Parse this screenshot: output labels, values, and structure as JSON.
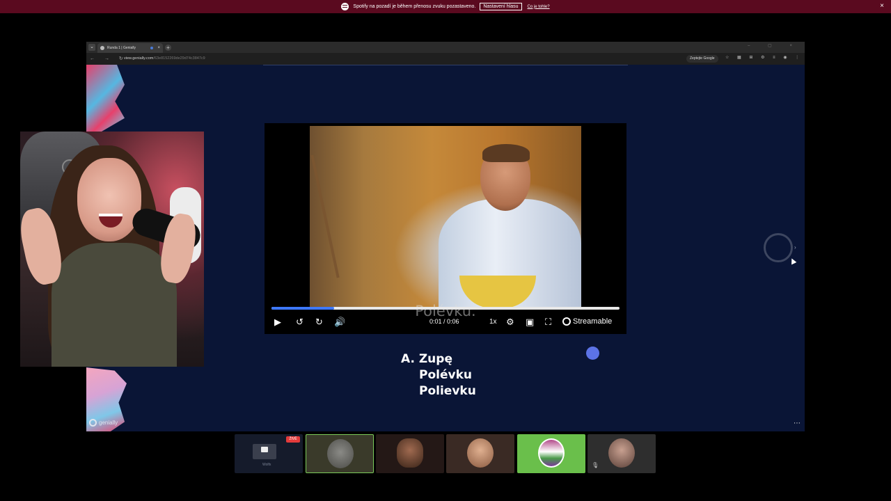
{
  "notification": {
    "message": "Spotify na pozadí je během přenosu zvuku pozastaveno.",
    "settings_button": "Nastavení hlasu",
    "link": "Co je tohle?",
    "close": "×"
  },
  "browser": {
    "tab_title": "Runda 1 | Genially",
    "tab_close": "×",
    "new_tab": "+",
    "window_controls": "– ▢ ×",
    "nav_icons": "← → ↻",
    "url_host": "view.genially.com",
    "url_path": "/63e8152269de29d74c3847c9",
    "lens_label": "Zeptejte Google",
    "extensions": "☆ ▦ ⊞ ⚙ ≡ ◉ ⋮"
  },
  "genially": {
    "logo_text": "genially",
    "answers": {
      "prefix": "A.",
      "items": [
        "Zupę",
        "Polévku",
        "Polievku"
      ]
    },
    "more": "⋯",
    "next_arrow": "›"
  },
  "player": {
    "subtitle": "Polévku.",
    "time": "0:01 / 0:06",
    "progress": 0.18,
    "speed": "1x",
    "brand": "Streamable",
    "icons": [
      "play-icon",
      "rewind-icon",
      "forward-icon",
      "volume-icon",
      "settings-icon",
      "pip-icon",
      "fullscreen-icon"
    ]
  },
  "participants": {
    "tile1_badge": "ŽIVĚ",
    "tile1_caption": "Wolfx",
    "mute_icon": "🎙"
  },
  "colors": {
    "accent": "#3d78ff",
    "page_bg": "#0a1536",
    "notif_bg": "#5a0a1f",
    "active_tile": "#6abf4b"
  }
}
